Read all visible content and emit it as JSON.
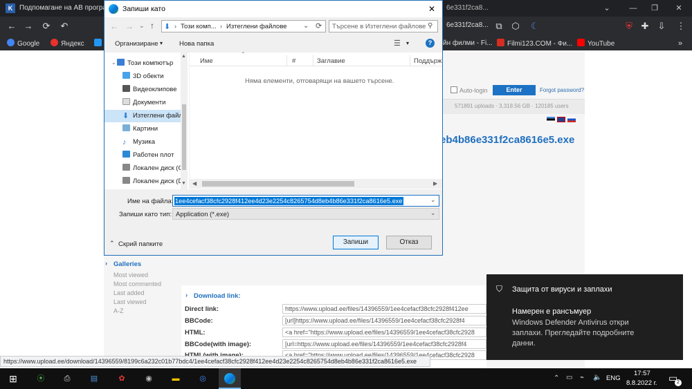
{
  "browser": {
    "tab_title": "Подпомагане на АВ програм",
    "address_fragment": "6e331f2ca8...",
    "bookmarks": [
      {
        "label": "Google",
        "color": "#4285f4"
      },
      {
        "label": "Яндекс",
        "color": "#e8322b"
      },
      {
        "label": "йн филми - Fi...",
        "color": "#555555"
      },
      {
        "label": "Filmi123.COM - Фи...",
        "color": "#d62d20"
      },
      {
        "label": "YouTube",
        "color": "#ff0000"
      }
    ]
  },
  "site": {
    "autologin_label": "Auto-login",
    "enter_button": "Enter",
    "forgot_link": "Forgot password?",
    "stats": "571891 uploads   ·   3,318.56 GB   ·   120185 users",
    "file_title": "eb4b86e331f2ca8616e5.exe",
    "galleries_title": "Galleries",
    "galleries": [
      "Most viewed",
      "Most commented",
      "Last added",
      "Last viewed",
      "A-Z"
    ],
    "download_title": "Download link:",
    "rows": [
      {
        "label": "Direct link:",
        "value": "https://www.upload.ee/files/14396559/1ee4cefacf38cfc2928f412ee"
      },
      {
        "label": "BBCode:",
        "value": "[url]https://www.upload.ee/files/14396559/1ee4cefacf38cfc2928f4"
      },
      {
        "label": "HTML:",
        "value": "<a href=\"https://www.upload.ee/files/14396559/1ee4cefacf38cfc2928"
      },
      {
        "label": "BBCode(with image):",
        "value": "[url=https://www.upload.ee/files/14396559/1ee4cefacf38cfc2928f4"
      },
      {
        "label": "HTML(with image):",
        "value": "<a href=\"https://www.upload.ee/files/14396559/1ee4cefacf38cfc2928"
      }
    ]
  },
  "status_url": "https://www.upload.ee/download/14396559/8199c6a232c01b77bdc4/1ee4cefacf38cfc2928f412ee4d23e2254c8265754d8eb4b86e331f2ca8616e5.exe",
  "dialog": {
    "title": "Запиши като",
    "breadcrumb": [
      "Този комп...",
      "Изтеглени файлове"
    ],
    "search_placeholder": "Търсене в Изтеглени файлове",
    "organize": "Организиране",
    "new_folder": "Нова папка",
    "nav_items": [
      {
        "label": "Този компютър",
        "color": "#3a7fd5"
      },
      {
        "label": "3D обекти",
        "color": "#4aa3e8"
      },
      {
        "label": "Видеоклипове",
        "color": "#555555"
      },
      {
        "label": "Документи",
        "color": "#dddddd"
      },
      {
        "label": "Изтеглени файлове",
        "color": "#2f7fd6"
      },
      {
        "label": "Картини",
        "color": "#7ab0d8"
      },
      {
        "label": "Музика",
        "color": "#3a7fd5"
      },
      {
        "label": "Работен плот",
        "color": "#2a8ad4"
      },
      {
        "label": "Локален диск (C:)",
        "color": "#888888"
      },
      {
        "label": "Локален диск (D:)",
        "color": "#888888"
      }
    ],
    "columns": [
      "Име",
      "#",
      "Заглавие",
      "Поддърж"
    ],
    "empty_message": "Няма елементи, отговарящи на вашето търсене.",
    "filename_label": "Име на файла:",
    "filename_value": "1ee4cefacf38cfc2928f412ee4d23e2254c8265754d8eb4b86e331f2ca8616e5.exe",
    "filetype_label": "Запиши като тип:",
    "filetype_value": "Application (*.exe)",
    "hide_folders": "Скрий папките",
    "save_button": "Запиши",
    "cancel_button": "Отказ"
  },
  "toast": {
    "title": "Защита от вируси и заплахи",
    "heading": "Намерен е рансъмуер",
    "body": "Windows Defender Antivirus откри заплахи. Прегледайте подробните данни."
  },
  "taskbar": {
    "language": "ENG",
    "time": "17:57",
    "date": "8.8.2022 г.",
    "notification_count": "2"
  },
  "colors": {
    "accent": "#0078d7",
    "dialog_border": "#1e6fb8",
    "toast_bg": "#1f1f1f"
  }
}
